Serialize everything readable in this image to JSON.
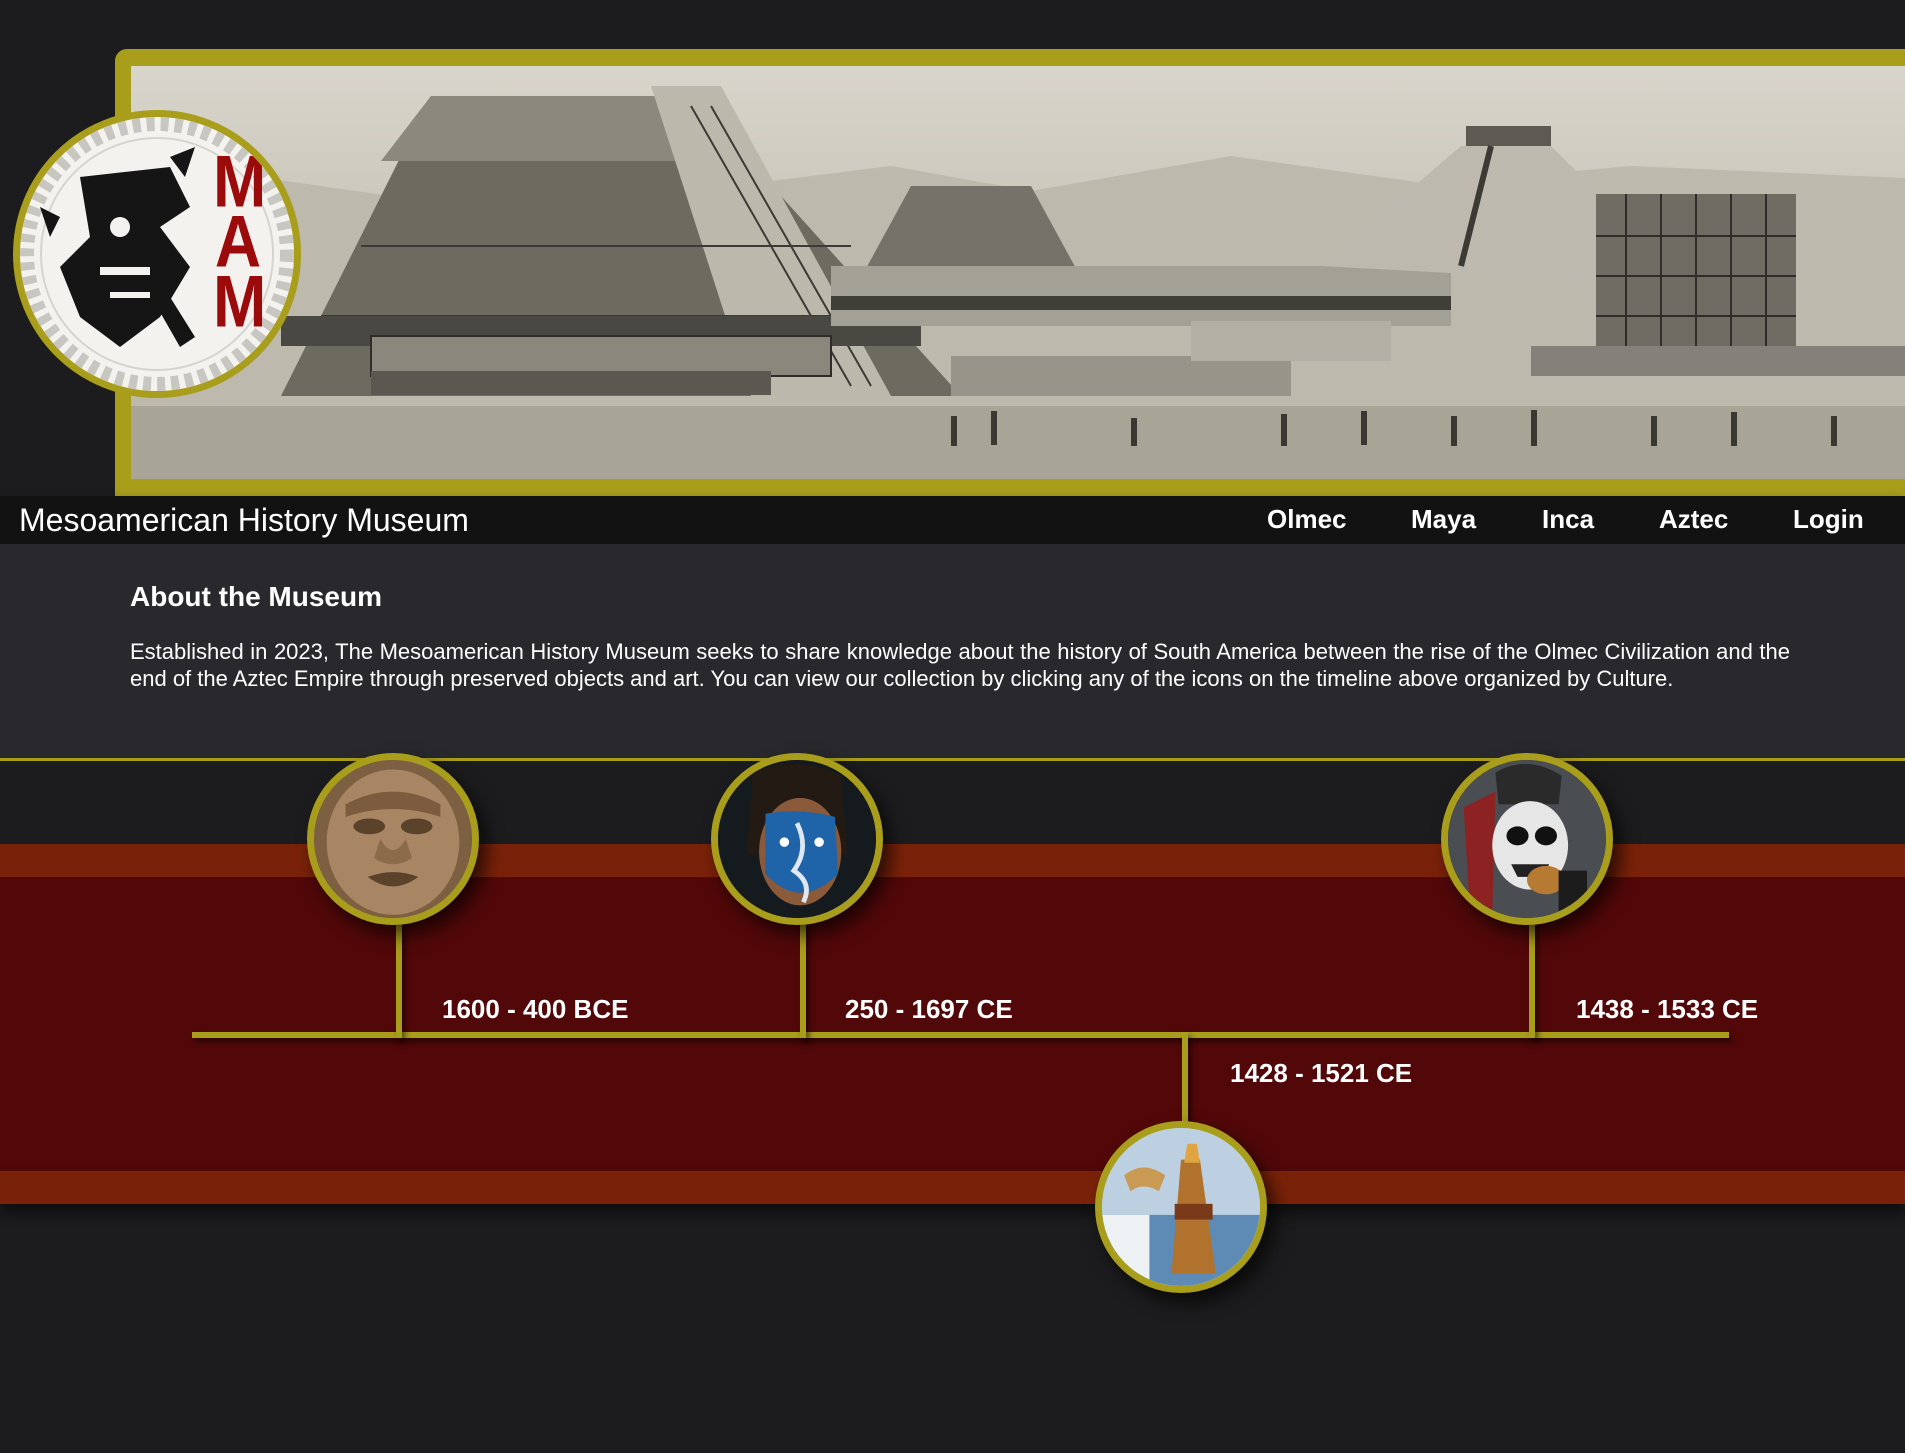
{
  "header": {
    "logo_letters": [
      "M",
      "A",
      "M"
    ],
    "site_title": "Mesoamerican History Museum"
  },
  "nav": {
    "items": [
      "Olmec",
      "Maya",
      "Inca",
      "Aztec",
      "Login"
    ]
  },
  "about": {
    "title": "About the Museum",
    "text": "Established in 2023, The Mesoamerican History Museum seeks to share knowledge about the history of South America between the rise of the Olmec Civilization and the end of the Aztec Empire through preserved objects and art. You can view our collection by clicking any of the icons on the timeline above organized by Culture."
  },
  "timeline": {
    "entries": [
      {
        "culture": "Olmec",
        "dates": "1600 - 400 BCE"
      },
      {
        "culture": "Maya",
        "dates": "250 - 1697 CE"
      },
      {
        "culture": "Inca",
        "dates": "1428 - 1521 CE"
      },
      {
        "culture": "Aztec",
        "dates": "1438 - 1533 CE"
      }
    ]
  },
  "colors": {
    "gold": "#a99d1c",
    "page_bg": "#1c1c1e",
    "about_bg": "#28282d",
    "band_red": "#520809",
    "band_orange": "#7a2209",
    "logo_red": "#9c0b0b"
  }
}
